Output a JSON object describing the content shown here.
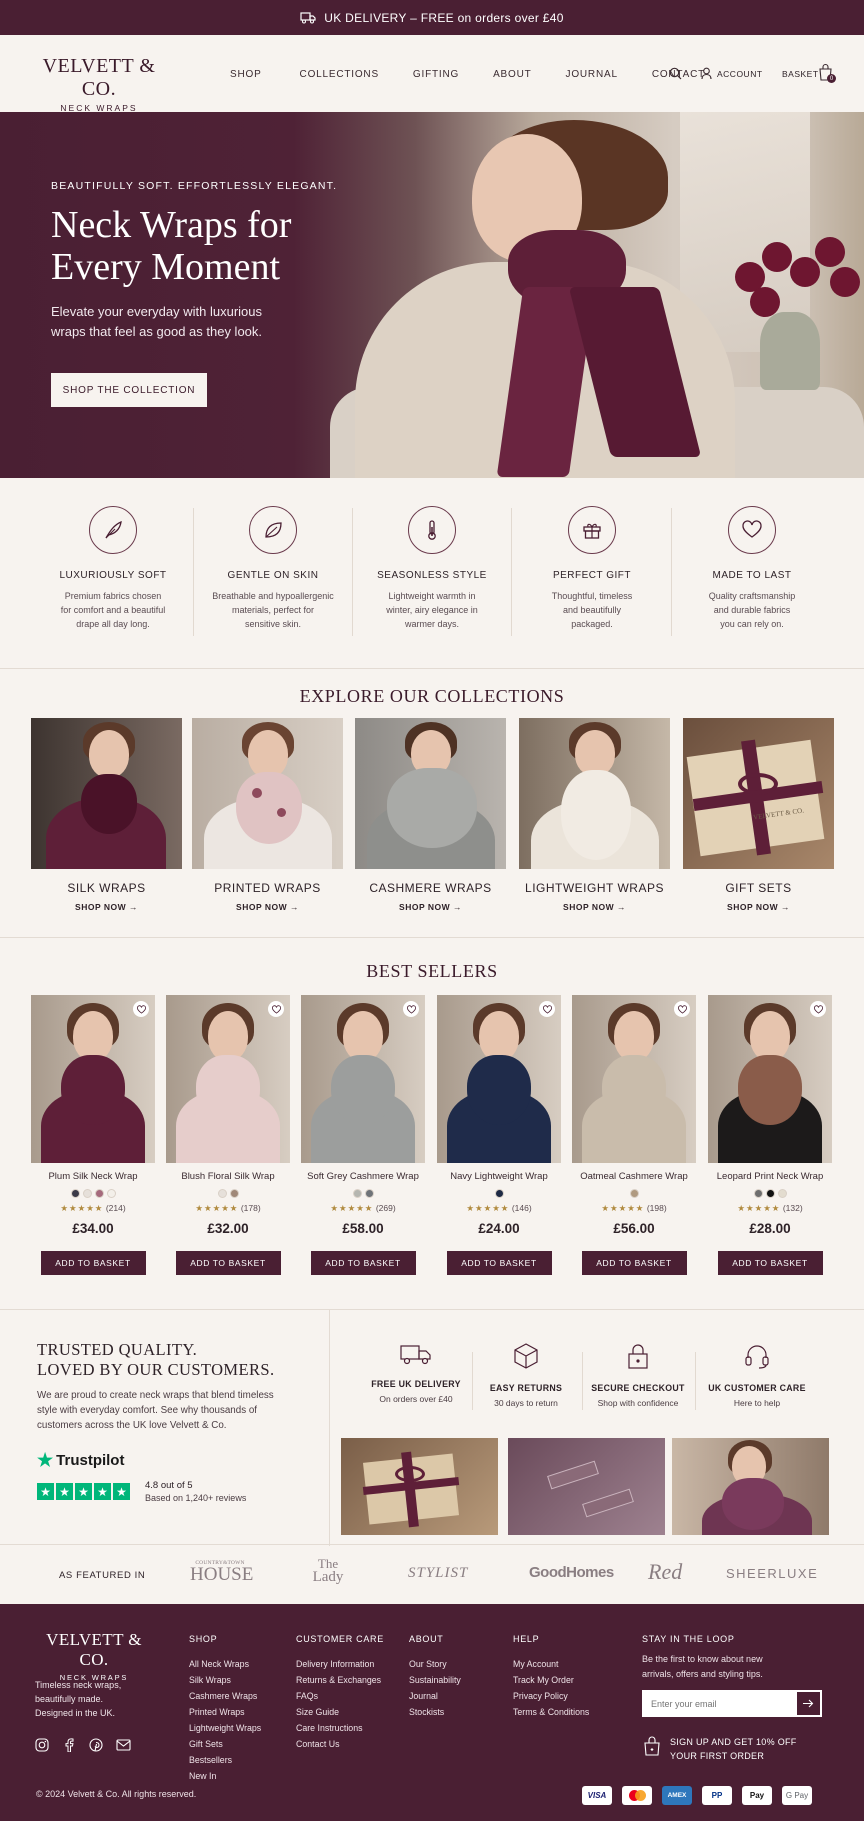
{
  "topbar": {
    "text": "UK DELIVERY – FREE on orders over £40"
  },
  "brand": {
    "name": "VELVETT & CO.",
    "tagline": "NECK WRAPS"
  },
  "nav": [
    "SHOP",
    "COLLECTIONS",
    "GIFTING",
    "ABOUT",
    "JOURNAL",
    "CONTACT"
  ],
  "header": {
    "account": "ACCOUNT",
    "basket": "BASKET",
    "basket_count": "0"
  },
  "hero": {
    "kicker": "BEAUTIFULLY SOFT. EFFORTLESSLY ELEGANT.",
    "title_l1": "Neck Wraps for",
    "title_l2": "Every Moment",
    "sub_l1": "Elevate your everyday with luxurious",
    "sub_l2": "wraps that feel as good as they look.",
    "cta": "SHOP THE COLLECTION"
  },
  "features": [
    {
      "icon": "feather-icon",
      "title": "LUXURIOUSLY SOFT",
      "l1": "Premium fabrics chosen",
      "l2": "for comfort and a beautiful",
      "l3": "drape all day long."
    },
    {
      "icon": "leaf-icon",
      "title": "GENTLE ON SKIN",
      "l1": "Breathable and hypoallergenic",
      "l2": "materials, perfect for",
      "l3": "sensitive skin."
    },
    {
      "icon": "thermometer-icon",
      "title": "SEASONLESS STYLE",
      "l1": "Lightweight warmth in",
      "l2": "winter, airy elegance in",
      "l3": "warmer days."
    },
    {
      "icon": "gift-icon",
      "title": "PERFECT GIFT",
      "l1": "Thoughtful, timeless",
      "l2": "and beautifully",
      "l3": "packaged."
    },
    {
      "icon": "heart-icon",
      "title": "MADE TO LAST",
      "l1": "Quality craftsmanship",
      "l2": "and durable fabrics",
      "l3": "you can rely on."
    }
  ],
  "collections": {
    "title": "EXPLORE OUR COLLECTIONS",
    "shop_label": "SHOP NOW →",
    "items": [
      {
        "name": "SILK WRAPS",
        "color": "#5e1f38"
      },
      {
        "name": "PRINTED WRAPS",
        "color": "#e8cfcf"
      },
      {
        "name": "CASHMERE WRAPS",
        "color": "#a7a8a4"
      },
      {
        "name": "LIGHTWEIGHT WRAPS",
        "color": "#e7e0d6"
      },
      {
        "name": "GIFT SETS",
        "color": "#d9c6a8"
      }
    ],
    "gift_box_text": "VELVETT & CO."
  },
  "bestsellers": {
    "title": "BEST SELLERS",
    "add_label": "ADD TO BASKET",
    "products": [
      {
        "name": "Plum Silk Neck Wrap",
        "price": "£34.00",
        "stars": "★★★★★",
        "reviews": "(214)",
        "rating": 4.8,
        "swatches": [
          "#3b3a48",
          "#e6e0da",
          "#a56a7c",
          "#f3efe9"
        ],
        "color": "#5e1f38"
      },
      {
        "name": "Blush Floral Silk Wrap",
        "price": "£32.00",
        "stars": "★★★★★",
        "reviews": "(178)",
        "rating": 4.7,
        "swatches": [
          "#e6e0da",
          "#a08878"
        ],
        "color": "#e6cdcb"
      },
      {
        "name": "Soft Grey Cashmere Wrap",
        "price": "£58.00",
        "stars": "★★★★★",
        "reviews": "(269)",
        "rating": 4.9,
        "swatches": [
          "#b5b6b0",
          "#6f7378"
        ],
        "color": "#9c9e9d"
      },
      {
        "name": "Navy Lightweight Wrap",
        "price": "£24.00",
        "stars": "★★★★★",
        "reviews": "(146)",
        "rating": 4.7,
        "swatches": [
          "#1e2a45"
        ],
        "color": "#1f2b4a"
      },
      {
        "name": "Oatmeal Cashmere Wrap",
        "price": "£56.00",
        "stars": "★★★★★",
        "reviews": "(198)",
        "rating": 4.8,
        "swatches": [
          "#b09a80"
        ],
        "color": "#c9bcab"
      },
      {
        "name": "Leopard Print Neck Wrap",
        "price": "£28.00",
        "stars": "★★★★★",
        "reviews": "(132)",
        "rating": 4.6,
        "swatches": [
          "#6e6e6e",
          "#111111",
          "#e3dccf"
        ],
        "color": "#8a5c4a"
      }
    ]
  },
  "trusted": {
    "title_l1": "TRUSTED QUALITY.",
    "title_l2": "LOVED BY OUR CUSTOMERS.",
    "text_l1": "We are proud to create neck wraps that blend timeless",
    "text_l2": "style with everyday comfort. See why thousands of",
    "text_l3": "customers across the UK love Velvett & Co.",
    "tp_name": "Trustpilot",
    "tp_score": "4.8 out of 5",
    "tp_count": "Based on 1,240+ reviews",
    "usps": [
      {
        "icon": "truck-icon",
        "title": "FREE UK DELIVERY",
        "desc": "On orders over £40"
      },
      {
        "icon": "box-icon",
        "title": "EASY RETURNS",
        "desc": "30 days to return"
      },
      {
        "icon": "lock-icon",
        "title": "SECURE CHECKOUT",
        "desc": "Shop with confidence"
      },
      {
        "icon": "headset-icon",
        "title": "UK CUSTOMER CARE",
        "desc": "Here to help"
      }
    ]
  },
  "featured": {
    "label": "AS FEATURED IN",
    "logo1_l1": "COUNTRY&TOWN",
    "logo1_l2": "HOUSE",
    "logo2_l1": "The",
    "logo2_l2": "Lady",
    "logo3": "STYLIST",
    "logo4": "GoodHomes",
    "logo5": "Red",
    "logo6": "SHEERLUXE"
  },
  "footer": {
    "tag_l1": "Timeless neck wraps,",
    "tag_l2": "beautifully made.",
    "tag_l3": "Designed in the UK.",
    "cols": [
      {
        "title": "SHOP",
        "items": [
          "All Neck Wraps",
          "Silk Wraps",
          "Cashmere Wraps",
          "Printed Wraps",
          "Lightweight Wraps",
          "Gift Sets",
          "Bestsellers",
          "New In"
        ]
      },
      {
        "title": "CUSTOMER CARE",
        "items": [
          "Delivery Information",
          "Returns & Exchanges",
          "FAQs",
          "Size Guide",
          "Care Instructions",
          "Contact Us"
        ]
      },
      {
        "title": "ABOUT",
        "items": [
          "Our Story",
          "Sustainability",
          "Journal",
          "Stockists"
        ]
      },
      {
        "title": "HELP",
        "items": [
          "My Account",
          "Track My Order",
          "Privacy Policy",
          "Terms & Conditions"
        ]
      }
    ],
    "stay_title": "STAY IN THE LOOP",
    "stay_l1": "Be the first to know about new",
    "stay_l2": "arrivals, offers and styling tips.",
    "email_placeholder": "Enter your email",
    "offer_l1": "SIGN UP AND GET 10% OFF",
    "offer_l2": "YOUR FIRST ORDER",
    "copyright": "© 2024 Velvett & Co. All rights reserved.",
    "payments": [
      "VISA",
      "MC",
      "AMEX",
      "PP",
      "Pay",
      "G Pay"
    ]
  }
}
